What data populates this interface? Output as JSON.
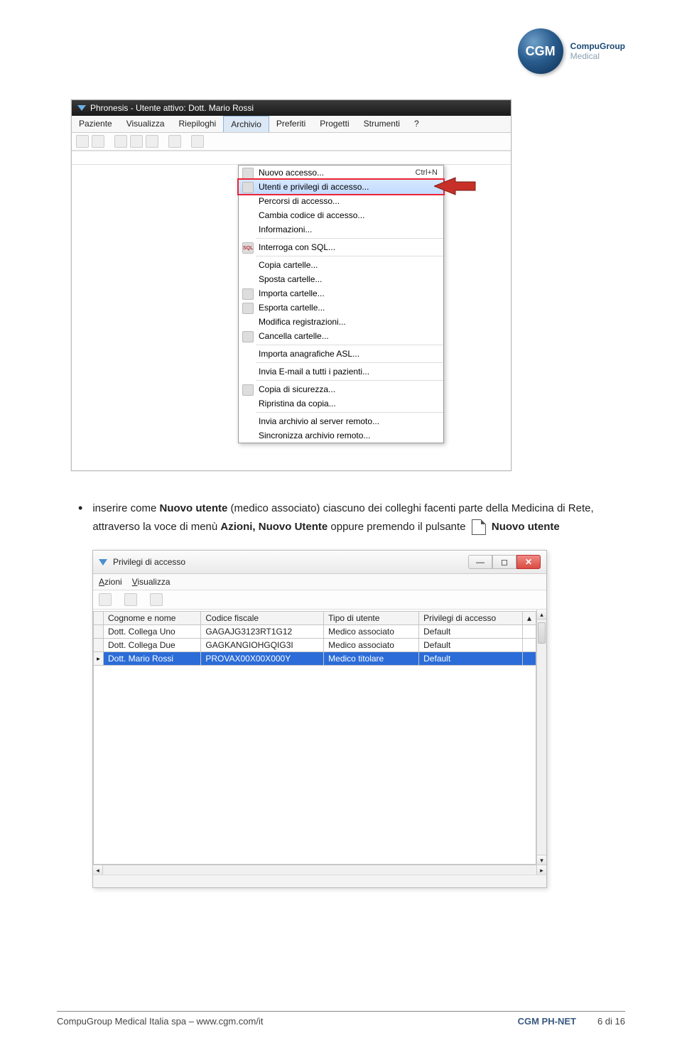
{
  "logo": {
    "abbr": "CGM",
    "line1": "CompuGroup",
    "line2": "Medical"
  },
  "shot1": {
    "title": "Phronesis - Utente attivo: Dott. Mario Rossi",
    "menubar": [
      "Paziente",
      "Visualizza",
      "Riepiloghi",
      "Archivio",
      "Preferiti",
      "Progetti",
      "Strumenti",
      "?"
    ],
    "open_index": 3,
    "dropdown": [
      {
        "label": "Nuovo accesso...",
        "shortcut": "Ctrl+N",
        "icon": true
      },
      {
        "label": "Utenti e privilegi di accesso...",
        "highlight": true,
        "icon": true
      },
      {
        "label": "Percorsi di accesso..."
      },
      {
        "label": "Cambia codice di accesso..."
      },
      {
        "label": "Informazioni..."
      },
      {
        "sep": true
      },
      {
        "label": "Interroga con SQL...",
        "icon": true,
        "icontext": "SQL"
      },
      {
        "sep": true
      },
      {
        "label": "Copia cartelle..."
      },
      {
        "label": "Sposta cartelle..."
      },
      {
        "label": "Importa cartelle...",
        "icon": true
      },
      {
        "label": "Esporta cartelle...",
        "icon": true
      },
      {
        "label": "Modifica registrazioni..."
      },
      {
        "label": "Cancella cartelle...",
        "icon": true
      },
      {
        "sep": true
      },
      {
        "label": "Importa anagrafiche ASL..."
      },
      {
        "sep": true
      },
      {
        "label": "Invia E-mail a tutti i pazienti..."
      },
      {
        "sep": true
      },
      {
        "label": "Copia di sicurezza...",
        "icon": true
      },
      {
        "label": "Ripristina da copia..."
      },
      {
        "sep": true
      },
      {
        "label": "Invia archivio al server remoto..."
      },
      {
        "label": "Sincronizza archivio remoto..."
      }
    ]
  },
  "instruction": {
    "pre": "inserire come ",
    "b1": "Nuovo utente",
    "mid1": " (medico associato) ciascuno dei colleghi facenti parte della Medicina di Rete, attraverso la voce di menù ",
    "b2": "Azioni, Nuovo Utente",
    "mid2": " oppure premendo il pulsante ",
    "b3": "Nuovo utente"
  },
  "shot2": {
    "title": "Privilegi di accesso",
    "menubar": [
      {
        "u": "A",
        "rest": "zioni"
      },
      {
        "u": "V",
        "rest": "isualizza"
      }
    ],
    "columns": [
      "Cognome e nome",
      "Codice fiscale",
      "Tipo di utente",
      "Privilegi di accesso"
    ],
    "rows": [
      {
        "c": [
          "Dott. Collega Uno",
          "GAGAJG3123RT1G12",
          "Medico associato",
          "Default"
        ],
        "sel": false
      },
      {
        "c": [
          "Dott. Collega Due",
          "GAGKANGIOHGQIG3I",
          "Medico associato",
          "Default"
        ],
        "sel": false
      },
      {
        "c": [
          "Dott. Mario Rossi",
          "PROVAX00X00X000Y",
          "Medico titolare",
          "Default"
        ],
        "sel": true
      }
    ]
  },
  "footer": {
    "left": "CompuGroup Medical Italia spa – www.cgm.com/it",
    "product": "CGM PH-NET",
    "page": "6 di 16"
  }
}
